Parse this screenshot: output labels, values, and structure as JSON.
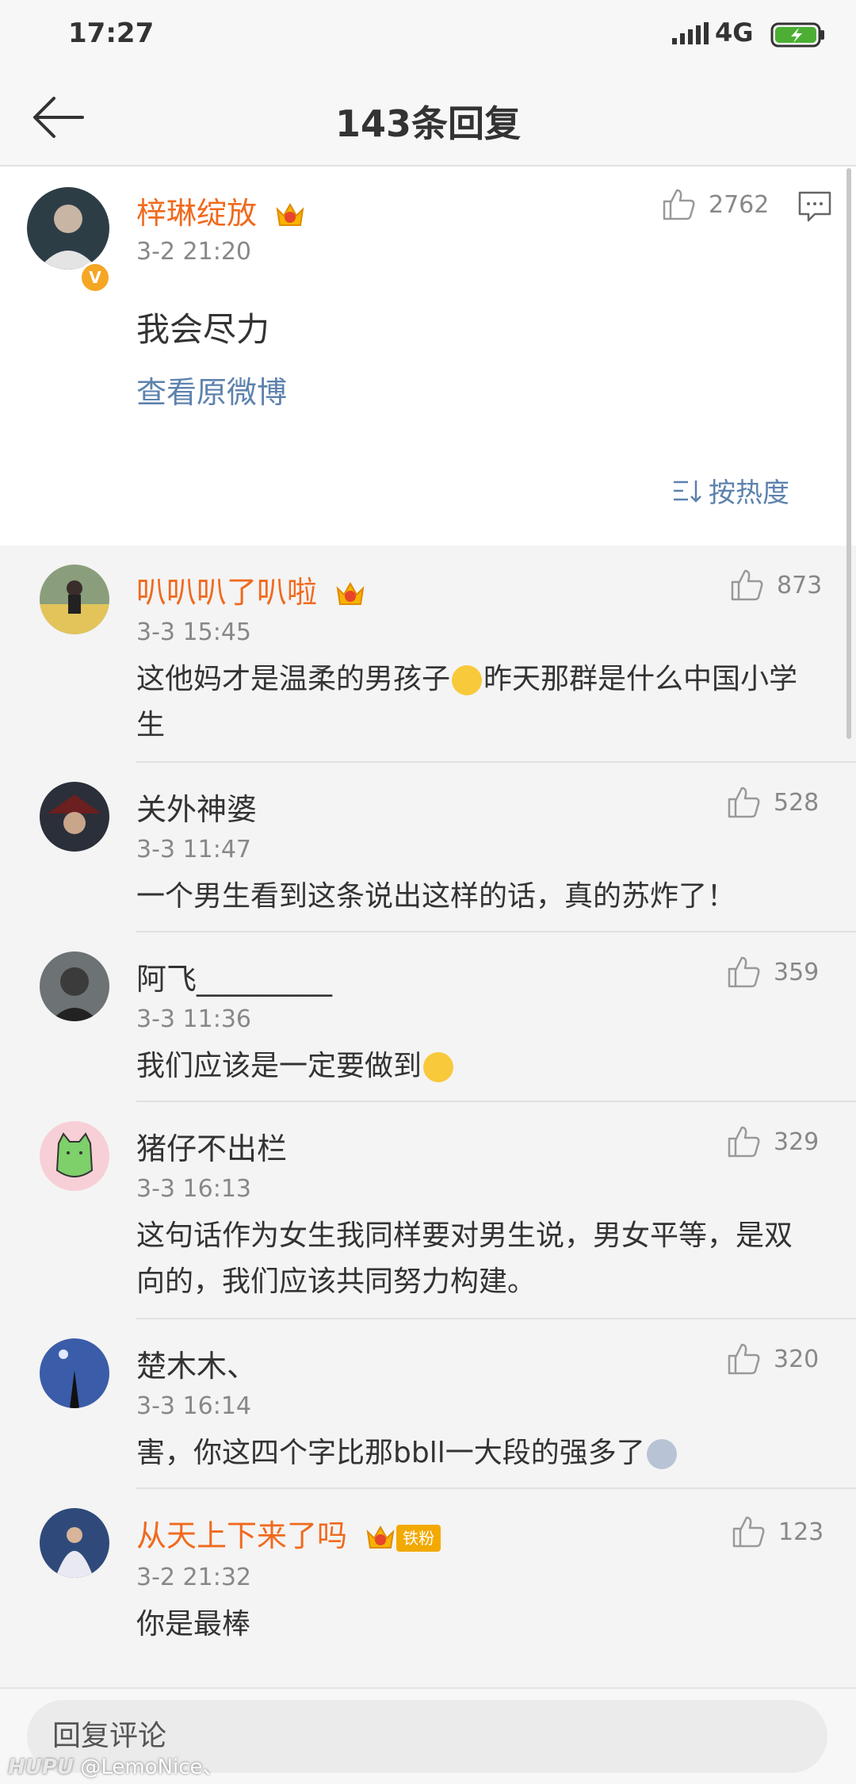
{
  "status": {
    "time": "17:27",
    "network": "4G"
  },
  "nav": {
    "title": "143条回复"
  },
  "post": {
    "username": "梓琳绽放",
    "timestamp": "3-2 21:20",
    "likes": "2762",
    "text": "我会尽力",
    "view_original": "查看原微博",
    "sort_label": "按热度"
  },
  "replies": [
    {
      "username": "叭叭叭了叭啦",
      "timestamp": "3-3 15:45",
      "likes": "873",
      "text_a": "这他妈才是温柔的男孩子",
      "text_b": "昨天那群是什么中国小学生"
    },
    {
      "username": "关外神婆",
      "timestamp": "3-3 11:47",
      "likes": "528",
      "text": "一个男生看到这条说出这样的话，真的苏炸了！"
    },
    {
      "username": "阿飞_________",
      "timestamp": "3-3 11:36",
      "likes": "359",
      "text": "我们应该是一定要做到"
    },
    {
      "username": "猪仔不出栏",
      "timestamp": "3-3 16:13",
      "likes": "329",
      "text": "这句话作为女生我同样要对男生说，男女平等，是双向的，我们应该共同努力构建。"
    },
    {
      "username": "楚木木、",
      "timestamp": "3-3 16:14",
      "likes": "320",
      "text": "害，你这四个字比那bbll一大段的强多了"
    },
    {
      "username": "从天上下来了吗",
      "fan_tag": "铁粉",
      "timestamp": "3-2 21:32",
      "likes": "123",
      "text": "你是最棒"
    }
  ],
  "reply_bar": {
    "placeholder": "回复评论"
  },
  "watermark": {
    "brand": "HUPU",
    "handle": "@LemoNice、"
  },
  "colors": {
    "accent_orange": "#f06a1e",
    "link_blue": "#5d82ad",
    "verified": "#f5a623"
  }
}
